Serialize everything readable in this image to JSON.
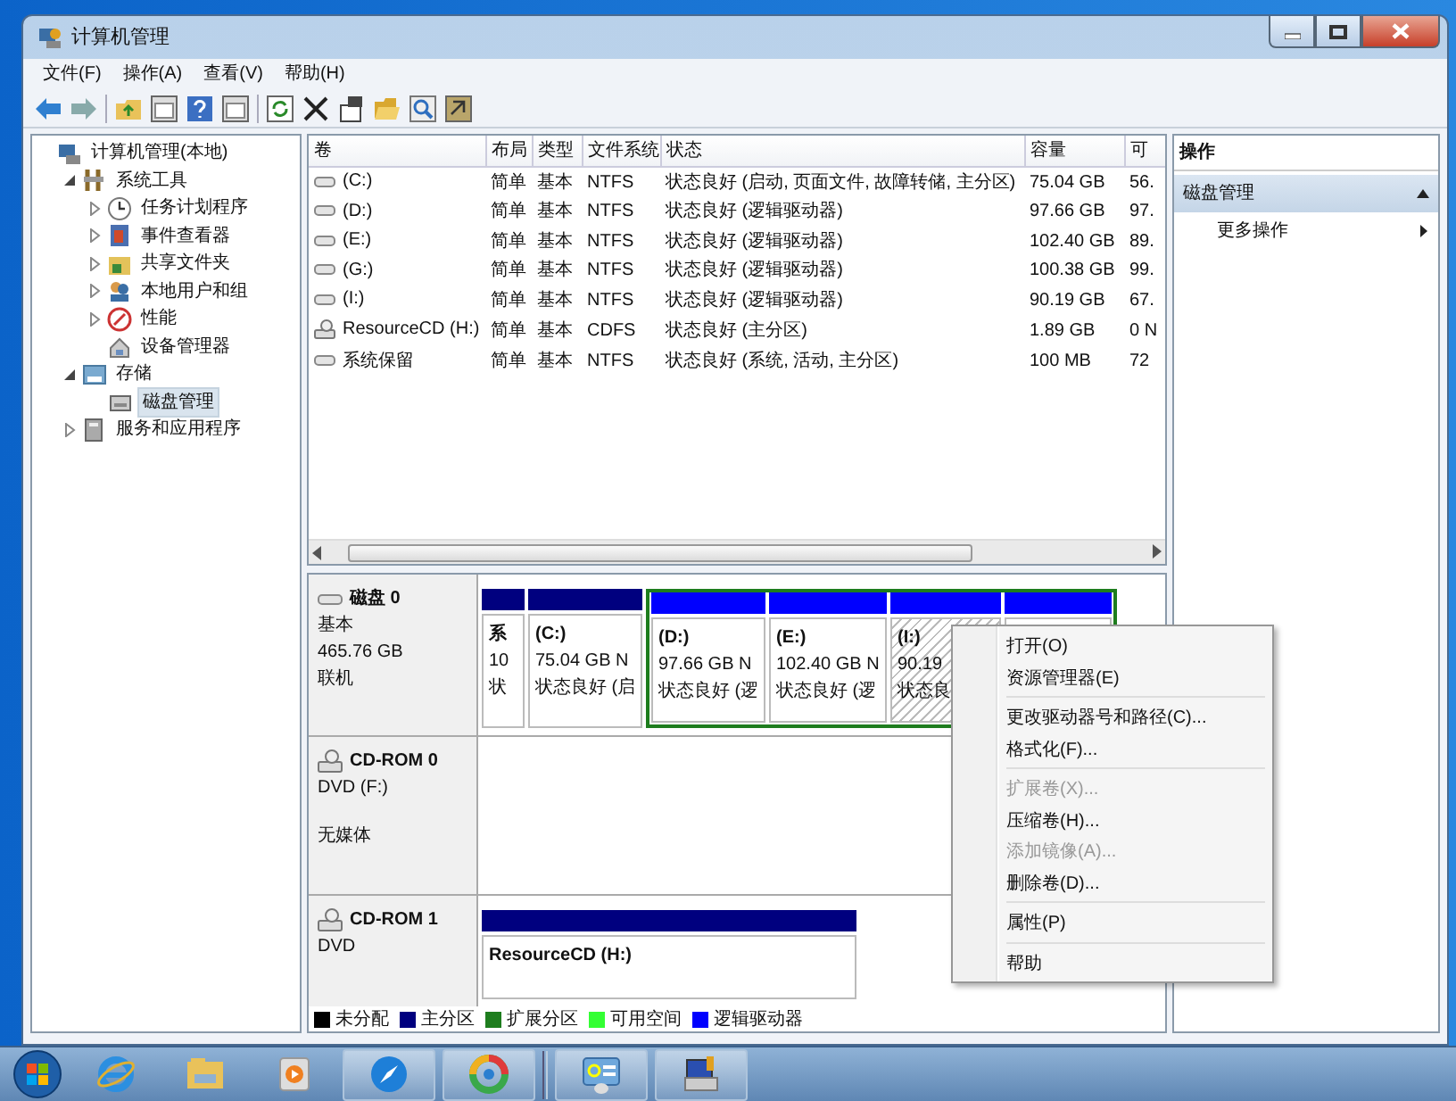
{
  "window": {
    "title": "计算机管理"
  },
  "menu": [
    "文件(F)",
    "操作(A)",
    "查看(V)",
    "帮助(H)"
  ],
  "tree": [
    {
      "label": "计算机管理(本地)",
      "selected": false,
      "children": [
        {
          "label": "系统工具",
          "expanded": true,
          "selected": false,
          "children": [
            {
              "label": "任务计划程序",
              "expanded": false,
              "selected": false
            },
            {
              "label": "事件查看器",
              "expanded": false,
              "selected": false
            },
            {
              "label": "共享文件夹",
              "expanded": false,
              "selected": false
            },
            {
              "label": "本地用户和组",
              "expanded": false,
              "selected": false
            },
            {
              "label": "性能",
              "expanded": false,
              "selected": false
            },
            {
              "label": "设备管理器",
              "selected": false
            }
          ]
        },
        {
          "label": "存储",
          "expanded": true,
          "selected": false,
          "children": [
            {
              "label": "磁盘管理",
              "selected": true
            }
          ]
        },
        {
          "label": "服务和应用程序",
          "expanded": false,
          "selected": false
        }
      ]
    }
  ],
  "volumes": {
    "columns": [
      "卷",
      "布局",
      "类型",
      "文件系统",
      "状态",
      "容量",
      "可"
    ],
    "rows": [
      {
        "kind": "disk",
        "cells": [
          "(C:)",
          "简单",
          "基本",
          "NTFS",
          "状态良好 (启动, 页面文件, 故障转储, 主分区)",
          "75.04 GB",
          "56."
        ]
      },
      {
        "kind": "disk",
        "cells": [
          "(D:)",
          "简单",
          "基本",
          "NTFS",
          "状态良好 (逻辑驱动器)",
          "97.66 GB",
          "97."
        ]
      },
      {
        "kind": "disk",
        "cells": [
          "(E:)",
          "简单",
          "基本",
          "NTFS",
          "状态良好 (逻辑驱动器)",
          "102.40 GB",
          "89."
        ]
      },
      {
        "kind": "disk",
        "cells": [
          "(G:)",
          "简单",
          "基本",
          "NTFS",
          "状态良好 (逻辑驱动器)",
          "100.38 GB",
          "99."
        ]
      },
      {
        "kind": "disk",
        "cells": [
          "(I:)",
          "简单",
          "基本",
          "NTFS",
          "状态良好 (逻辑驱动器)",
          "90.19 GB",
          "67."
        ]
      },
      {
        "kind": "cd",
        "cells": [
          "ResourceCD (H:)",
          "简单",
          "基本",
          "CDFS",
          "状态良好 (主分区)",
          "1.89 GB",
          "0 N"
        ]
      },
      {
        "kind": "disk",
        "cells": [
          "系统保留",
          "简单",
          "基本",
          "NTFS",
          "状态良好 (系统, 活动, 主分区)",
          "100 MB",
          "72"
        ]
      }
    ]
  },
  "disks": [
    {
      "kind": "disk",
      "name": "磁盘 0",
      "lines": [
        "基本",
        "465.76 GB",
        "联机"
      ],
      "partitions": [
        {
          "kind": "primary",
          "selected": false,
          "lines": [
            "系",
            "10",
            "状"
          ]
        },
        {
          "kind": "primary",
          "selected": false,
          "lines": [
            "(C:)",
            "75.04 GB N",
            "状态良好 (启"
          ]
        },
        {
          "kind": "extended",
          "children": [
            {
              "kind": "logical",
              "selected": false,
              "lines": [
                "(D:)",
                "97.66 GB N",
                "状态良好 (逻"
              ]
            },
            {
              "kind": "logical",
              "selected": false,
              "lines": [
                "(E:)",
                "102.40 GB N",
                "状态良好 (逻"
              ]
            },
            {
              "kind": "logical",
              "selected": true,
              "lines": [
                "(I:)",
                "90.19",
                "状态良"
              ]
            },
            {
              "kind": "logical",
              "selected": false
            }
          ]
        }
      ]
    },
    {
      "kind": "cdrom",
      "name": "CD-ROM 0",
      "lines": [
        "DVD (F:)",
        "无媒体"
      ]
    },
    {
      "kind": "cdrom",
      "name": "CD-ROM 1",
      "lines": [
        "DVD"
      ],
      "partitions": [
        {
          "kind": "primary",
          "selected": false,
          "lines": [
            "ResourceCD  (H:)"
          ]
        }
      ]
    }
  ],
  "legend": [
    {
      "label": "未分配",
      "color": "#000000"
    },
    {
      "label": "主分区",
      "color": "#00007f"
    },
    {
      "label": "扩展分区",
      "color": "#1e7d1e"
    },
    {
      "label": "可用空间",
      "color": "#33ff33"
    },
    {
      "label": "逻辑驱动器",
      "color": "#0000ff"
    }
  ],
  "actions": {
    "title": "操作",
    "section": {
      "label": "磁盘管理",
      "expanded": true
    },
    "items": [
      "更多操作"
    ]
  },
  "context_menu": [
    [
      {
        "label": "打开(O)",
        "disabled": false
      },
      {
        "label": "资源管理器(E)",
        "disabled": false
      }
    ],
    [
      {
        "label": "更改驱动器号和路径(C)...",
        "disabled": false
      },
      {
        "label": "格式化(F)...",
        "disabled": false
      }
    ],
    [
      {
        "label": "扩展卷(X)...",
        "disabled": true
      },
      {
        "label": "压缩卷(H)...",
        "disabled": false
      },
      {
        "label": "添加镜像(A)...",
        "disabled": true
      },
      {
        "label": "删除卷(D)...",
        "disabled": false
      }
    ],
    [
      {
        "label": "属性(P)",
        "disabled": false
      }
    ],
    [
      {
        "label": "帮助",
        "disabled": false
      }
    ]
  ]
}
